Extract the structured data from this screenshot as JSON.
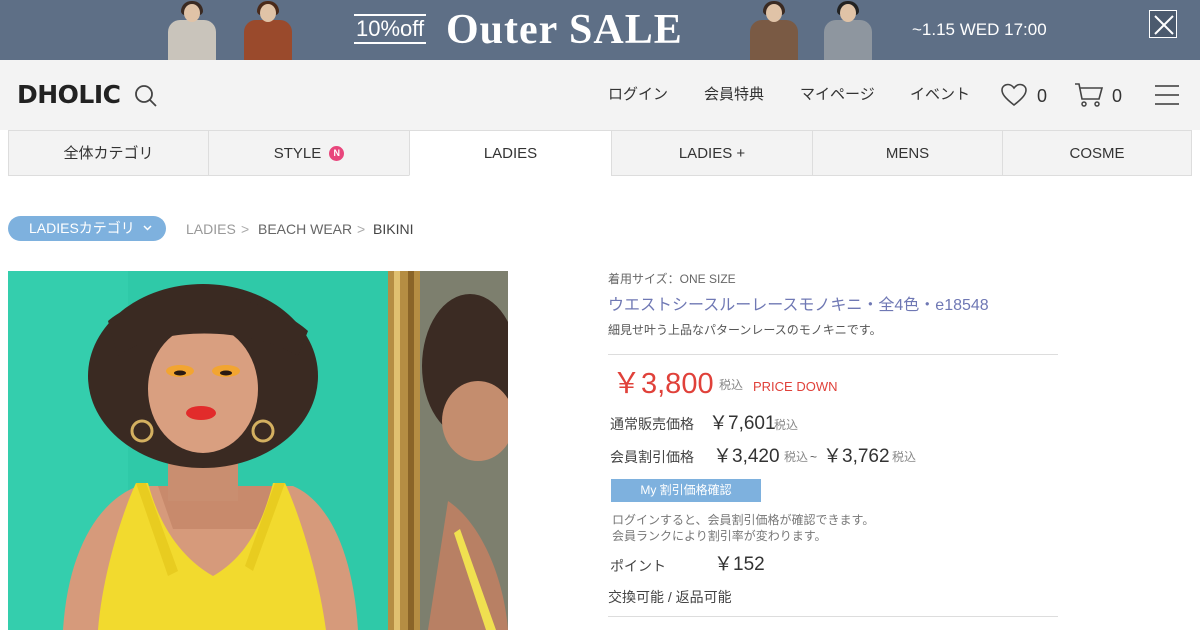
{
  "banner": {
    "discount": "10%off",
    "title": "Outer SALE",
    "date": "~1.15 WED 17:00"
  },
  "header": {
    "logo": "DHOLIC",
    "nav": [
      "ログイン",
      "会員特典",
      "マイページ",
      "イベント"
    ],
    "wishlist_count": "0",
    "cart_count": "0"
  },
  "tabs": [
    {
      "label": "全体カテゴリ",
      "badge": ""
    },
    {
      "label": "STYLE",
      "badge": "N"
    },
    {
      "label": "LADIES",
      "badge": ""
    },
    {
      "label": "LADIES +",
      "badge": ""
    },
    {
      "label": "MENS",
      "badge": ""
    },
    {
      "label": "COSME",
      "badge": ""
    }
  ],
  "category_button": "LADIESカテゴリ",
  "breadcrumb": [
    "LADIES",
    "BEACH WEAR",
    "BIKINI"
  ],
  "breadcrumb_sep": ">",
  "product": {
    "size_note": "着用サイズ：ONE SIZE",
    "name": "ウエストシースルーレースモノキニ・全4色・e18548",
    "description": "細見せ叶う上品なパターンレースのモノキニです。",
    "price": "￥3,800",
    "tax_label": "税込",
    "price_badge": "PRICE DOWN",
    "regular_label": "通常販売価格",
    "regular_price": "￥7,601",
    "member_label": "会員割引価格",
    "member_price_min": "￥3,420",
    "member_price_sep": "~",
    "member_price_max": "￥3,762",
    "my_discount_button": "My 割引価格確認",
    "login_note_1": "ログインすると、会員割引価格が確認できます。",
    "login_note_2": "会員ランクにより割引率が変わります。",
    "points_label": "ポイント",
    "points": "￥152",
    "exchange": "交換可能 / 返品可能"
  },
  "colors": {
    "banner_bg": "#5e6f86",
    "accent_blue": "#7eb1de",
    "price_red": "#e0413a",
    "name_purple": "#6f78b4",
    "badge_pink": "#e8467c",
    "photo_bg": "#2fc9a8"
  }
}
